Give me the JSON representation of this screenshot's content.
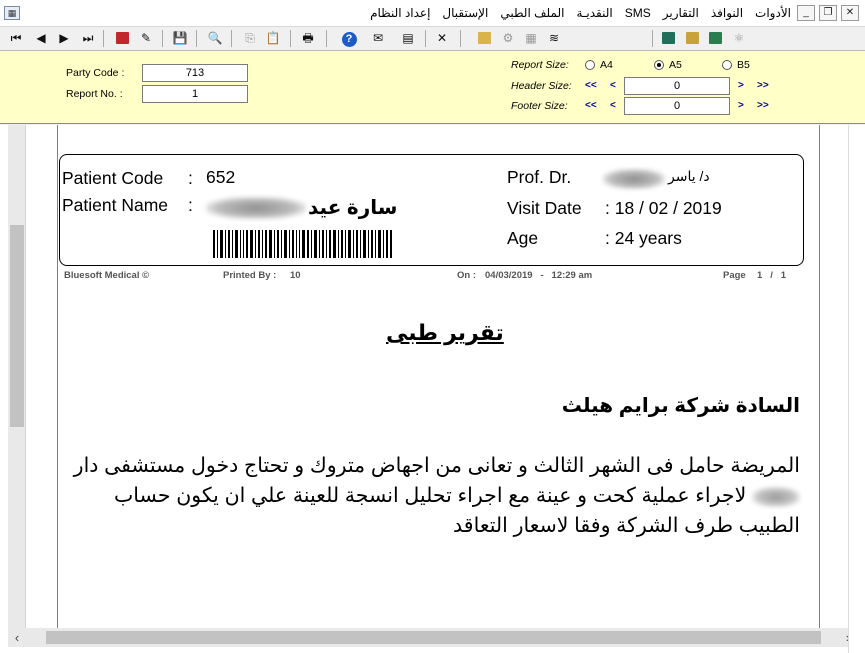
{
  "menubar": {
    "menus": [
      "إعداد النظام",
      "الإستقبال",
      "الملف الطبي",
      "النقديـة",
      "SMS",
      "التقارير",
      "النوافذ",
      "الأدوات"
    ]
  },
  "window_controls": {
    "minimize": "_",
    "restore": "❐",
    "close": "✕"
  },
  "toolbar": {
    "icons": [
      "first-page-icon",
      "previous-page-icon",
      "next-page-icon",
      "last-page-icon",
      "export-icon",
      "eraser-icon",
      "save-icon",
      "zoom-icon",
      "copy-icon",
      "paste-icon",
      "print-icon",
      "help-icon",
      "envelope-icon",
      "report-icon",
      "close-icon",
      "stack-icon",
      "tree-icon",
      "grid-icon",
      "layers-icon",
      "calculator-icon",
      "robot-icon",
      "drive-icon",
      "network-icon"
    ]
  },
  "params": {
    "party_code_label": "Party Code :",
    "party_code_value": "713",
    "report_no_label": "Report No. :",
    "report_no_value": "1",
    "report_size_label": "Report Size:",
    "sizes": [
      "A4",
      "A5",
      "B5"
    ],
    "selected_size": "A5",
    "header_size_label": "Header Size:",
    "header_size_value": "0",
    "footer_size_label": "Footer Size:",
    "footer_size_value": "0",
    "rewind": "<<",
    "back": "<",
    "forward": ">",
    "fast_forward": ">>"
  },
  "report": {
    "patient_code_label": "Patient Code",
    "colon": ":",
    "patient_code_value": "652",
    "patient_name_label": "Patient Name",
    "patient_name_value": "سارة عيد",
    "doctor_label": "Prof. Dr.",
    "doctor_value": "د/ ياسر",
    "visit_date_label": "Visit Date",
    "visit_date_value": ": 18 / 02 / 2019",
    "age_label": "Age",
    "age_value": ": 24 years",
    "footer_company": "Bluesoft Medical ©",
    "footer_printed_by_label": "Printed By :",
    "footer_printed_by_value": "10",
    "footer_on_label": "On :",
    "footer_on_value": "04/03/2019   -   12:29 am",
    "footer_page_label": "Page",
    "footer_page_value": "1   /   1",
    "title": "تقرير طبى",
    "to_line": "السادة شركة برايم هيلث",
    "body_part1": "المريضة حامل فى الشهر الثالث و تعانى من اجهاض متروك و تحتاج دخول مستشفى دار",
    "body_part2": "لاجراء عملية كحت و عينة مع اجراء تحليل انسجة للعينة علي ان يكون حساب الطبيب طرف الشركة وفقا لاسعار التعاقد"
  },
  "scroll": {
    "left_arrow": "‹",
    "right_arrow": "›"
  },
  "colors": {
    "param_panel_bg": "#ffffc8",
    "arrow_blue": "#0000aa"
  }
}
